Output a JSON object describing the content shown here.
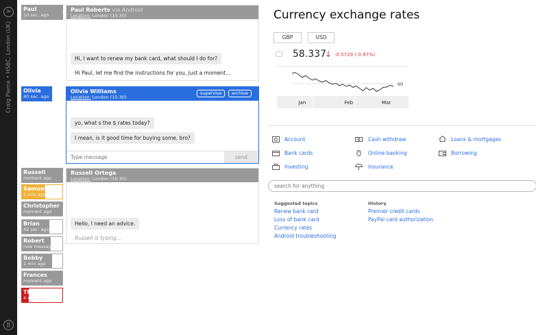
{
  "agent": {
    "label": "Craig Pierce • HSBC, London (UK)"
  },
  "sessions": [
    {
      "name": "Paul",
      "time": "10 sec. ago"
    },
    {
      "name": "Olivia",
      "time": "40 sec. ago"
    },
    {
      "name": "Russell",
      "time": "moment ago"
    },
    {
      "name": "Samuel",
      "time": "1 min ago"
    },
    {
      "name": "Christopher",
      "time": "moment ago"
    },
    {
      "name": "Brian",
      "time": "42 sec. ago"
    },
    {
      "name": "Robert",
      "time": "new message"
    },
    {
      "name": "Bobby",
      "time": "1 min ago"
    },
    {
      "name": "Frances",
      "time": "moment ago"
    },
    {
      "name": "Thomas",
      "time": "4 min ago"
    }
  ],
  "chats": {
    "paul": {
      "name": "Paul Roberts",
      "via": "via Android",
      "location_label": "Location:",
      "location": "London (15:30)",
      "messages": [
        "Hi, I want to renew my bank card, what should I do for?",
        "Hi Paul, let me find the instructions for you, just a moment..."
      ]
    },
    "olivia": {
      "name": "Olivia Williams",
      "location_label": "Location:",
      "location": "London (15:30)",
      "supervise": "supervise",
      "archive": "archive",
      "messages": [
        "yo, what s the $ rates today?",
        "I mean, is it good time for buying some, bro?"
      ],
      "input_placeholder": "Type message",
      "send": "send"
    },
    "russell": {
      "name": "Russell Ortega",
      "location_label": "Location:",
      "location": "London (15:30)",
      "messages": [
        "Hello, I need an advice."
      ],
      "typing": "Russell is typing..."
    }
  },
  "rates": {
    "title": "Currency exchange rates",
    "tabs": [
      "GBP",
      "USD"
    ],
    "price": "58.337",
    "change": "-0.5729 (-0.97%)",
    "colors": {
      "down": "#dd3333",
      "accent": "#2a6ede"
    }
  },
  "chart_data": {
    "type": "line",
    "categories": [
      "Jan",
      "Feb",
      "Mar"
    ],
    "x": [
      0,
      0.5,
      1,
      1.5,
      2,
      2.5,
      3,
      3.5,
      4,
      4.5,
      5,
      5.5,
      6,
      6.5,
      7,
      7.5,
      8,
      8.5,
      9,
      9.5,
      10,
      10.5,
      11,
      11.5,
      12,
      12.5,
      13,
      13.5,
      14,
      14.5,
      15
    ],
    "values": [
      63.0,
      63.2,
      62.6,
      61.8,
      62.3,
      61.6,
      61.0,
      61.4,
      60.8,
      60.4,
      60.9,
      60.2,
      59.8,
      60.1,
      59.4,
      59.8,
      59.2,
      59.6,
      58.9,
      59.3,
      58.6,
      57.9,
      58.8,
      58.1,
      58.6,
      57.7,
      58.2,
      58.9,
      59.0,
      59.5,
      59.2
    ],
    "yticks": [
      60
    ],
    "ylim": [
      56,
      64
    ],
    "grid": true
  },
  "services": [
    {
      "label": "Account",
      "icon": "safe-icon"
    },
    {
      "label": "Cash withdraw",
      "icon": "cash-icon"
    },
    {
      "label": "Loans & mortgages",
      "icon": "house-icon"
    },
    {
      "label": "Bank cards",
      "icon": "card-icon"
    },
    {
      "label": "Online banking",
      "icon": "mouse-icon"
    },
    {
      "label": "Borrowing",
      "icon": "wallet-icon"
    },
    {
      "label": "Investing",
      "icon": "briefcase-icon"
    },
    {
      "label": "Insurance",
      "icon": "umbrella-icon"
    }
  ],
  "search": {
    "placeholder": "search for anything"
  },
  "suggested": {
    "heading": "Suggested topics",
    "items": [
      "Renew bank card",
      "Loss of bank card",
      "Currency rates",
      "Android troubleshooting"
    ]
  },
  "history": {
    "heading": "History",
    "items": [
      "Premier credit cards",
      "PayPal card authorization"
    ]
  }
}
